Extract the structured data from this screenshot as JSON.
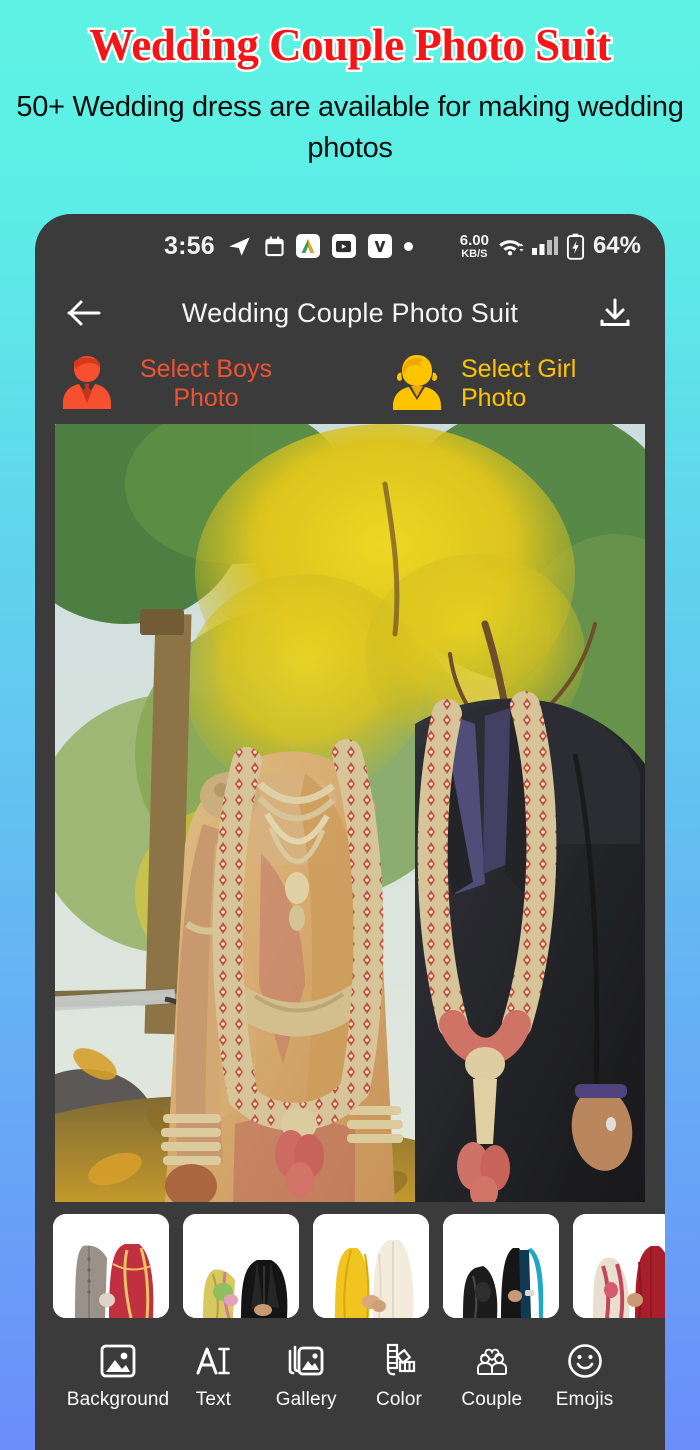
{
  "promo": {
    "title": "Wedding Couple Photo Suit",
    "subtitle": "50+ Wedding dress are available for making wedding photos",
    "title_color": "#f41616",
    "title_stroke_color": "#ffffff",
    "bg_top_color": "#5ef2e4",
    "bg_bottom_color": "#6b8efa"
  },
  "statusbar": {
    "time": "3:56",
    "icons": [
      "telegram-icon",
      "calendar-icon",
      "app-a-icon",
      "video-box-icon",
      "v-app-icon",
      "dot-icon"
    ],
    "network_speed_value": "6.00",
    "network_speed_unit": "KB/S",
    "wifi": "wifi-icon",
    "signal": "cellular-signal-icon",
    "battery_percent": "64%",
    "battery_state": "charging"
  },
  "appbar": {
    "back": "back-arrow-icon",
    "title": "Wedding Couple Photo Suit",
    "download": "download-icon"
  },
  "select_row": {
    "boys": {
      "label": "Select Boys Photo",
      "icon": "male-avatar-icon",
      "color": "#f05232"
    },
    "girl": {
      "label": "Select Girl Photo",
      "icon": "female-avatar-icon",
      "color": "#ffc400"
    }
  },
  "canvas": {
    "name": "wedding-couple-photo",
    "description": "Couple in traditional Indian wedding attire with flower garlands, autumn garden background"
  },
  "thumbnails": [
    {
      "name": "thumb-sherwani-red-lehenga"
    },
    {
      "name": "thumb-black-suit-floral"
    },
    {
      "name": "thumb-yellow-saree-cream-kurta"
    },
    {
      "name": "thumb-black-saree-teal-kurta"
    },
    {
      "name": "thumb-red-saree-maroon-sherwani"
    },
    {
      "name": "thumb-partial"
    }
  ],
  "toolbar": [
    {
      "label": "Background",
      "icon": "image-icon"
    },
    {
      "label": "Text",
      "icon": "text-icon"
    },
    {
      "label": "Gallery",
      "icon": "gallery-icon"
    },
    {
      "label": "Color",
      "icon": "palette-icon"
    },
    {
      "label": "Couple",
      "icon": "couple-heart-icon"
    },
    {
      "label": "Emojis",
      "icon": "smiley-icon"
    }
  ]
}
